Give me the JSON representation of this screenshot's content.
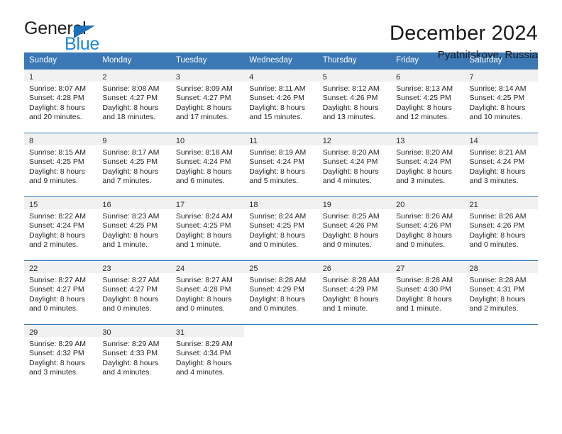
{
  "brand": {
    "name_top": "General",
    "name_bottom": "Blue",
    "accent_color": "#2186d6",
    "triangle_color": "#1d70b8"
  },
  "header": {
    "title": "December 2024",
    "location": "Pyatnitskoye, Russia"
  },
  "calendar": {
    "header_bg": "#3b78b5",
    "header_text_color": "#ffffff",
    "daynum_band_bg": "#f1f1f1",
    "weekdays": [
      "Sunday",
      "Monday",
      "Tuesday",
      "Wednesday",
      "Thursday",
      "Friday",
      "Saturday"
    ],
    "weeks": [
      [
        {
          "day": "1",
          "sunrise": "Sunrise: 8:07 AM",
          "sunset": "Sunset: 4:28 PM",
          "daylight_line1": "Daylight: 8 hours",
          "daylight_line2": "and 20 minutes."
        },
        {
          "day": "2",
          "sunrise": "Sunrise: 8:08 AM",
          "sunset": "Sunset: 4:27 PM",
          "daylight_line1": "Daylight: 8 hours",
          "daylight_line2": "and 18 minutes."
        },
        {
          "day": "3",
          "sunrise": "Sunrise: 8:09 AM",
          "sunset": "Sunset: 4:27 PM",
          "daylight_line1": "Daylight: 8 hours",
          "daylight_line2": "and 17 minutes."
        },
        {
          "day": "4",
          "sunrise": "Sunrise: 8:11 AM",
          "sunset": "Sunset: 4:26 PM",
          "daylight_line1": "Daylight: 8 hours",
          "daylight_line2": "and 15 minutes."
        },
        {
          "day": "5",
          "sunrise": "Sunrise: 8:12 AM",
          "sunset": "Sunset: 4:26 PM",
          "daylight_line1": "Daylight: 8 hours",
          "daylight_line2": "and 13 minutes."
        },
        {
          "day": "6",
          "sunrise": "Sunrise: 8:13 AM",
          "sunset": "Sunset: 4:25 PM",
          "daylight_line1": "Daylight: 8 hours",
          "daylight_line2": "and 12 minutes."
        },
        {
          "day": "7",
          "sunrise": "Sunrise: 8:14 AM",
          "sunset": "Sunset: 4:25 PM",
          "daylight_line1": "Daylight: 8 hours",
          "daylight_line2": "and 10 minutes."
        }
      ],
      [
        {
          "day": "8",
          "sunrise": "Sunrise: 8:15 AM",
          "sunset": "Sunset: 4:25 PM",
          "daylight_line1": "Daylight: 8 hours",
          "daylight_line2": "and 9 minutes."
        },
        {
          "day": "9",
          "sunrise": "Sunrise: 8:17 AM",
          "sunset": "Sunset: 4:25 PM",
          "daylight_line1": "Daylight: 8 hours",
          "daylight_line2": "and 7 minutes."
        },
        {
          "day": "10",
          "sunrise": "Sunrise: 8:18 AM",
          "sunset": "Sunset: 4:24 PM",
          "daylight_line1": "Daylight: 8 hours",
          "daylight_line2": "and 6 minutes."
        },
        {
          "day": "11",
          "sunrise": "Sunrise: 8:19 AM",
          "sunset": "Sunset: 4:24 PM",
          "daylight_line1": "Daylight: 8 hours",
          "daylight_line2": "and 5 minutes."
        },
        {
          "day": "12",
          "sunrise": "Sunrise: 8:20 AM",
          "sunset": "Sunset: 4:24 PM",
          "daylight_line1": "Daylight: 8 hours",
          "daylight_line2": "and 4 minutes."
        },
        {
          "day": "13",
          "sunrise": "Sunrise: 8:20 AM",
          "sunset": "Sunset: 4:24 PM",
          "daylight_line1": "Daylight: 8 hours",
          "daylight_line2": "and 3 minutes."
        },
        {
          "day": "14",
          "sunrise": "Sunrise: 8:21 AM",
          "sunset": "Sunset: 4:24 PM",
          "daylight_line1": "Daylight: 8 hours",
          "daylight_line2": "and 3 minutes."
        }
      ],
      [
        {
          "day": "15",
          "sunrise": "Sunrise: 8:22 AM",
          "sunset": "Sunset: 4:24 PM",
          "daylight_line1": "Daylight: 8 hours",
          "daylight_line2": "and 2 minutes."
        },
        {
          "day": "16",
          "sunrise": "Sunrise: 8:23 AM",
          "sunset": "Sunset: 4:25 PM",
          "daylight_line1": "Daylight: 8 hours",
          "daylight_line2": "and 1 minute."
        },
        {
          "day": "17",
          "sunrise": "Sunrise: 8:24 AM",
          "sunset": "Sunset: 4:25 PM",
          "daylight_line1": "Daylight: 8 hours",
          "daylight_line2": "and 1 minute."
        },
        {
          "day": "18",
          "sunrise": "Sunrise: 8:24 AM",
          "sunset": "Sunset: 4:25 PM",
          "daylight_line1": "Daylight: 8 hours",
          "daylight_line2": "and 0 minutes."
        },
        {
          "day": "19",
          "sunrise": "Sunrise: 8:25 AM",
          "sunset": "Sunset: 4:26 PM",
          "daylight_line1": "Daylight: 8 hours",
          "daylight_line2": "and 0 minutes."
        },
        {
          "day": "20",
          "sunrise": "Sunrise: 8:26 AM",
          "sunset": "Sunset: 4:26 PM",
          "daylight_line1": "Daylight: 8 hours",
          "daylight_line2": "and 0 minutes."
        },
        {
          "day": "21",
          "sunrise": "Sunrise: 8:26 AM",
          "sunset": "Sunset: 4:26 PM",
          "daylight_line1": "Daylight: 8 hours",
          "daylight_line2": "and 0 minutes."
        }
      ],
      [
        {
          "day": "22",
          "sunrise": "Sunrise: 8:27 AM",
          "sunset": "Sunset: 4:27 PM",
          "daylight_line1": "Daylight: 8 hours",
          "daylight_line2": "and 0 minutes."
        },
        {
          "day": "23",
          "sunrise": "Sunrise: 8:27 AM",
          "sunset": "Sunset: 4:27 PM",
          "daylight_line1": "Daylight: 8 hours",
          "daylight_line2": "and 0 minutes."
        },
        {
          "day": "24",
          "sunrise": "Sunrise: 8:27 AM",
          "sunset": "Sunset: 4:28 PM",
          "daylight_line1": "Daylight: 8 hours",
          "daylight_line2": "and 0 minutes."
        },
        {
          "day": "25",
          "sunrise": "Sunrise: 8:28 AM",
          "sunset": "Sunset: 4:29 PM",
          "daylight_line1": "Daylight: 8 hours",
          "daylight_line2": "and 0 minutes."
        },
        {
          "day": "26",
          "sunrise": "Sunrise: 8:28 AM",
          "sunset": "Sunset: 4:29 PM",
          "daylight_line1": "Daylight: 8 hours",
          "daylight_line2": "and 1 minute."
        },
        {
          "day": "27",
          "sunrise": "Sunrise: 8:28 AM",
          "sunset": "Sunset: 4:30 PM",
          "daylight_line1": "Daylight: 8 hours",
          "daylight_line2": "and 1 minute."
        },
        {
          "day": "28",
          "sunrise": "Sunrise: 8:28 AM",
          "sunset": "Sunset: 4:31 PM",
          "daylight_line1": "Daylight: 8 hours",
          "daylight_line2": "and 2 minutes."
        }
      ],
      [
        {
          "day": "29",
          "sunrise": "Sunrise: 8:29 AM",
          "sunset": "Sunset: 4:32 PM",
          "daylight_line1": "Daylight: 8 hours",
          "daylight_line2": "and 3 minutes."
        },
        {
          "day": "30",
          "sunrise": "Sunrise: 8:29 AM",
          "sunset": "Sunset: 4:33 PM",
          "daylight_line1": "Daylight: 8 hours",
          "daylight_line2": "and 4 minutes."
        },
        {
          "day": "31",
          "sunrise": "Sunrise: 8:29 AM",
          "sunset": "Sunset: 4:34 PM",
          "daylight_line1": "Daylight: 8 hours",
          "daylight_line2": "and 4 minutes."
        },
        {
          "day": "",
          "sunrise": "",
          "sunset": "",
          "daylight_line1": "",
          "daylight_line2": ""
        },
        {
          "day": "",
          "sunrise": "",
          "sunset": "",
          "daylight_line1": "",
          "daylight_line2": ""
        },
        {
          "day": "",
          "sunrise": "",
          "sunset": "",
          "daylight_line1": "",
          "daylight_line2": ""
        },
        {
          "day": "",
          "sunrise": "",
          "sunset": "",
          "daylight_line1": "",
          "daylight_line2": ""
        }
      ]
    ]
  }
}
